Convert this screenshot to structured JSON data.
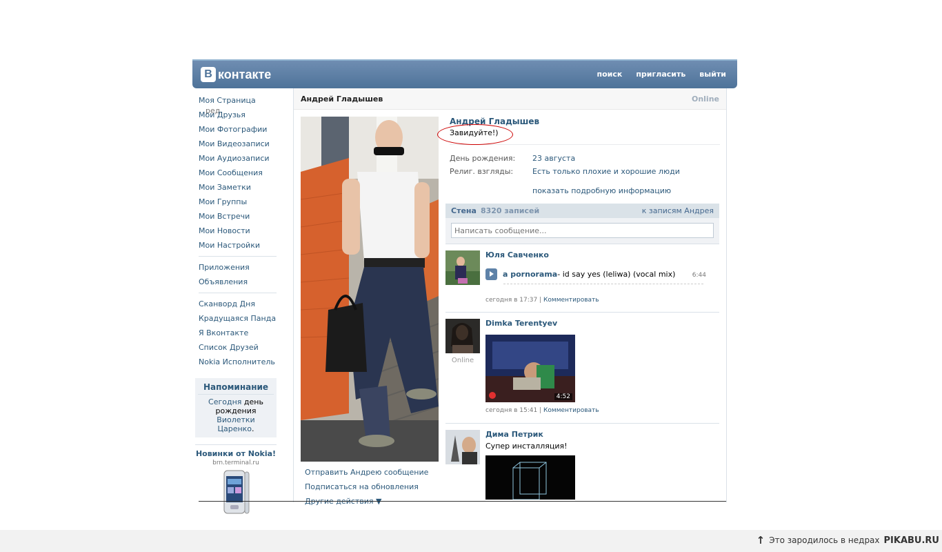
{
  "header": {
    "logo_letter": "В",
    "logo_text": "контакте",
    "nav": [
      "поиск",
      "пригласить",
      "выйти"
    ]
  },
  "leftnav": {
    "group1": [
      "Мои Друзья",
      "Мои Фотографии",
      "Мои Видеозаписи",
      "Мои Аудиозаписи",
      "Мои Сообщения",
      "Мои Заметки",
      "Мои Группы",
      "Мои Встречи",
      "Мои Новости",
      "Мои Настройки"
    ],
    "my_page": "Моя Страница",
    "edit": "ред.",
    "group2": [
      "Приложения",
      "Объявления"
    ],
    "group3": [
      "Сканворд Дня",
      "Крадущаяся Панда",
      "Я Вконтакте",
      "Список Друзей",
      "Nokia Исполнитель"
    ],
    "reminder": {
      "title": "Напоминание",
      "today": "Сегодня",
      "text1": "день рождения",
      "person": "Виолетки Царенко",
      "dot": "."
    },
    "nokia": {
      "title": "Новинки от Nokia!",
      "sub": "brn.terminal.ru"
    }
  },
  "profile": {
    "header_name": "Андрей Гладышев",
    "online": "Online",
    "name": "Андрей Гладышев",
    "status": "Завидуйте!)",
    "rows": [
      {
        "label": "День рождения:",
        "value": "23 августа"
      },
      {
        "label": "Религ. взгляды:",
        "value": "Есть только плохие и хорошие люди"
      }
    ],
    "more": "показать подробную информацию",
    "actions": [
      "Отправить Андрею сообщение",
      "Подписаться на обновления",
      "Другие действия ▼"
    ]
  },
  "wall": {
    "title": "Стена",
    "count": "8320 записей",
    "to_posts": "к записям Андрея",
    "placeholder": "Написать сообщение...",
    "posts": [
      {
        "author": "Юля Савченко",
        "audio_artist": "a pornorama",
        "audio_title": " - id say yes (leliwa) (vocal mix)",
        "audio_duration": "6:44",
        "time": "сегодня в 17:37",
        "sep": "|",
        "comment": "Комментировать"
      },
      {
        "author": "Dimka Terentyev",
        "online": "Online",
        "video_duration": "4:52",
        "time": "сегодня в 15:41",
        "sep": "|",
        "comment": "Комментировать"
      },
      {
        "author": "Дима Петрик",
        "text": "Супер инсталляция!"
      }
    ]
  },
  "watermark": {
    "prefix": "Это зародилось в недрах",
    "brand": "PIKABU.RU"
  },
  "colors": {
    "header_top": "#6f8db2",
    "header_bottom": "#4e7399",
    "link": "#2b587a",
    "wall_head": "#dae2e8"
  }
}
